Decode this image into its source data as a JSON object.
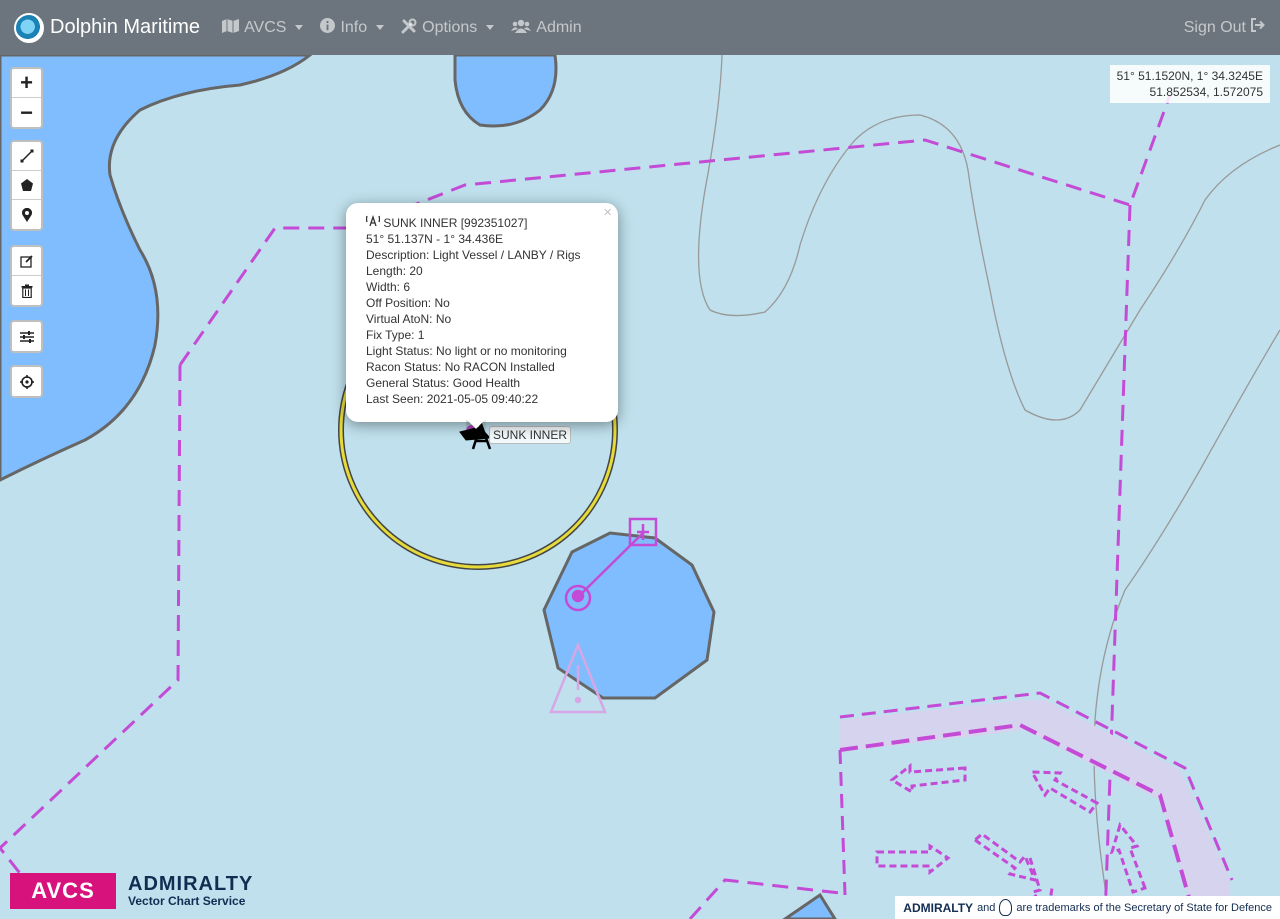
{
  "navbar": {
    "brand": "Dolphin Maritime",
    "items": [
      {
        "label": "AVCS",
        "icon": "map-icon",
        "dropdown": true
      },
      {
        "label": "Info",
        "icon": "info-icon",
        "dropdown": true
      },
      {
        "label": "Options",
        "icon": "tools-icon",
        "dropdown": true
      },
      {
        "label": "Admin",
        "icon": "users-icon",
        "dropdown": false
      }
    ],
    "signout": "Sign Out"
  },
  "coords": {
    "dms": "51° 51.1520N, 1° 34.3245E",
    "decimal": "51.852534, 1.572075"
  },
  "popup": {
    "title": "SUNK INNER [992351027]",
    "lines": [
      "51° 51.137N - 1° 34.436E",
      "Description: Light Vessel / LANBY / Rigs",
      "Length: 20",
      "Width: 6",
      "Off Position: No",
      "Virtual AtoN: No",
      "Fix Type: 1",
      "Light Status: No light or no monitoring",
      "Racon Status: No RACON Installed",
      "General Status: Good Health",
      "Last Seen: 2021-05-05 09:40:22"
    ],
    "close": "×"
  },
  "marker_label": "SUNK INNER",
  "footer": {
    "avcs": "AVCS",
    "admiralty": "ADMIRALTY",
    "subtitle": "Vector Chart Service",
    "tm_brand": "ADMIRALTY",
    "tm_and": "and",
    "tm_text": "are trademarks of the Secretary of State for Defence"
  },
  "colors": {
    "navbar": "#6c757d",
    "sea": "#bfe0ec",
    "shallow": "#80bdff",
    "magenta": "#c44bd6",
    "avcs": "#d8127d"
  }
}
